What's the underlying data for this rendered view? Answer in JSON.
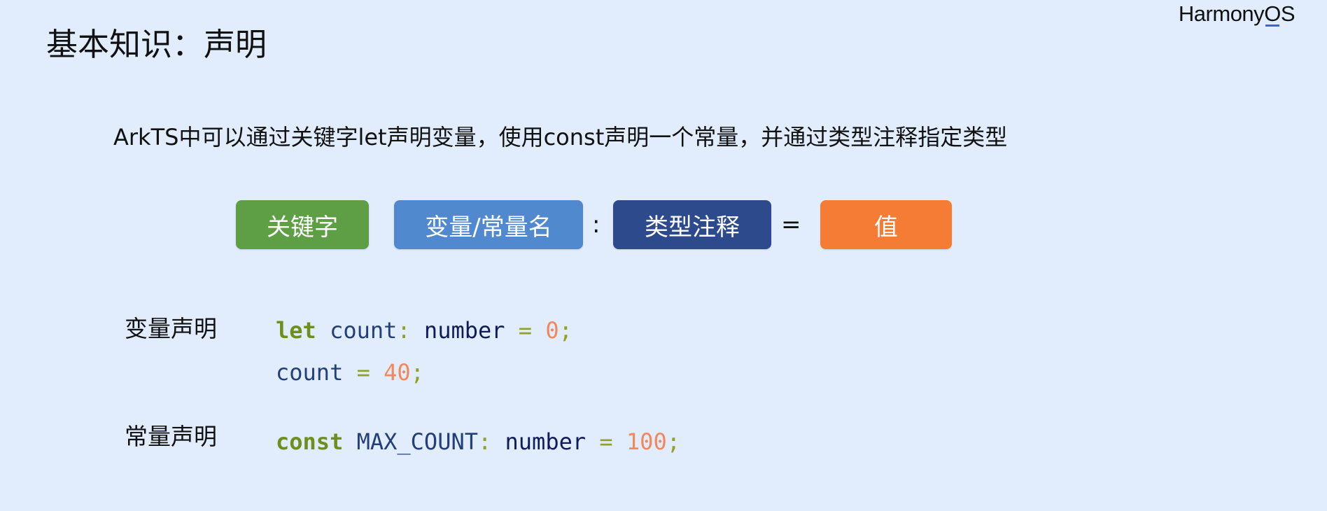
{
  "brand": {
    "logo_main": "Harmony",
    "logo_o": "O",
    "logo_s": "S"
  },
  "title": "基本知识：声明",
  "intro": "ArkTS中可以通过关键字let声明变量，使用const声明一个常量，并通过类型注释指定类型",
  "syntax": {
    "keyword": "关键字",
    "name": "变量/常量名",
    "colon": ":",
    "type": "类型注释",
    "equals": "=",
    "value": "值"
  },
  "colors": {
    "background": "#e1edfc",
    "keyword_pill": "#5e9e45",
    "name_pill": "#5089cd",
    "type_pill": "#2d4b8c",
    "value_pill": "#f47c34",
    "code_keyword": "#6f8f1c",
    "code_number": "#f3865a"
  },
  "examples": {
    "variable_label": "变量声明",
    "constant_label": "常量声明",
    "line1": {
      "kw": "let",
      "name": "count",
      "colon": ":",
      "type": "number",
      "eq": "=",
      "val": "0",
      "end": ";"
    },
    "line2": {
      "name": "count",
      "eq": "=",
      "val": "40",
      "end": ";"
    },
    "line3": {
      "kw": "const",
      "name": "MAX_COUNT",
      "colon": ":",
      "type": "number",
      "eq": "=",
      "val": "100",
      "end": ";"
    }
  }
}
